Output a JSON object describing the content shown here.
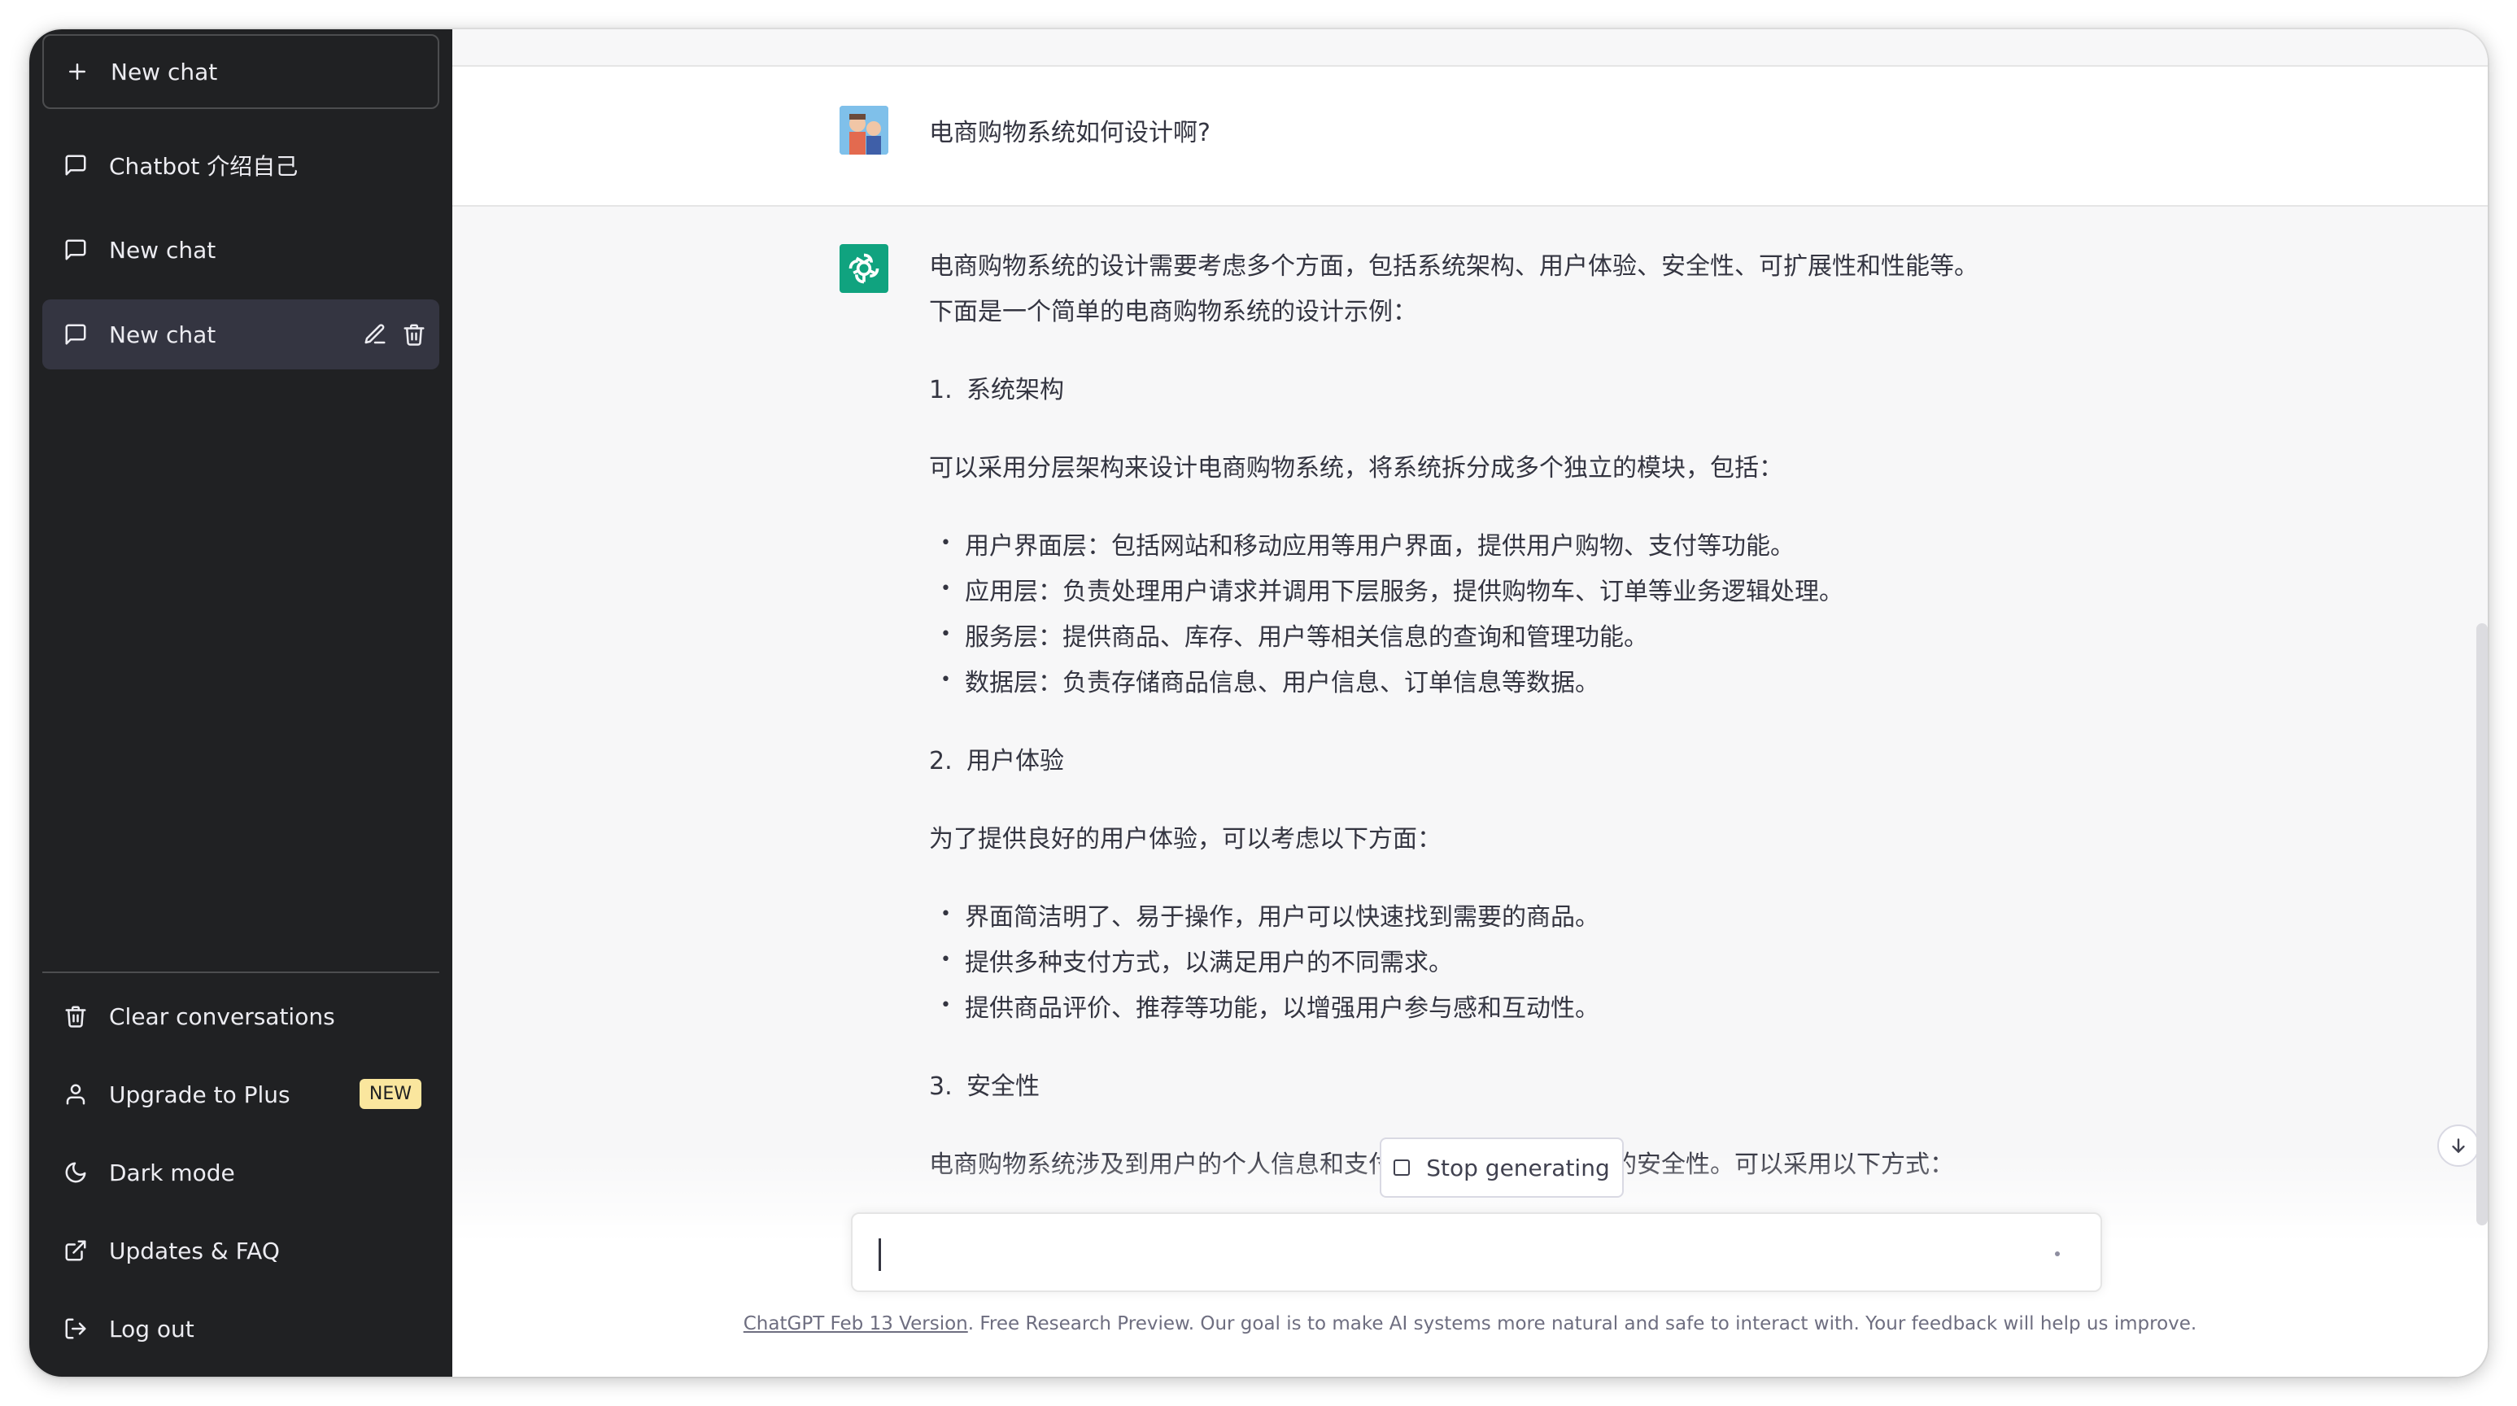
{
  "sidebar": {
    "new_chat": "New chat",
    "conversations": [
      {
        "label": "Chatbot 介绍自己"
      },
      {
        "label": "New chat"
      },
      {
        "label": "New chat"
      }
    ],
    "bottom": {
      "clear": "Clear conversations",
      "upgrade": "Upgrade to Plus",
      "upgrade_badge": "NEW",
      "dark_mode": "Dark mode",
      "updates": "Updates & FAQ",
      "logout": "Log out"
    }
  },
  "chat": {
    "user_message": "电商购物系统如何设计啊?",
    "answer": {
      "intro": "电商购物系统的设计需要考虑多个方面，包括系统架构、用户体验、安全性、可扩展性和性能等。下面是一个简单的电商购物系统的设计示例：",
      "sections": [
        {
          "num": "1.",
          "title": "系统架构",
          "desc": "可以采用分层架构来设计电商购物系统，将系统拆分成多个独立的模块，包括：",
          "bullets": [
            "用户界面层：包括网站和移动应用等用户界面，提供用户购物、支付等功能。",
            "应用层：负责处理用户请求并调用下层服务，提供购物车、订单等业务逻辑处理。",
            "服务层：提供商品、库存、用户等相关信息的查询和管理功能。",
            "数据层：负责存储商品信息、用户信息、订单信息等数据。"
          ]
        },
        {
          "num": "2.",
          "title": "用户体验",
          "desc": "为了提供良好的用户体验，可以考虑以下方面：",
          "bullets": [
            "界面简洁明了、易于操作，用户可以快速找到需要的商品。",
            "提供多种支付方式，以满足用户的不同需求。",
            "提供商品评价、推荐等功能，以增强用户参与感和互动性。"
          ]
        },
        {
          "num": "3.",
          "title": "安全性",
          "desc": "电商购物系统涉及到用户的个人信息和支付信息，需要保证数据的安全性。可以采用以下方式："
        }
      ]
    },
    "stop_button": "Stop generating"
  },
  "footer": {
    "version_link": "ChatGPT Feb 13 Version",
    "text": ". Free Research Preview. Our goal is to make AI systems more natural and safe to interact with. Your feedback will help us improve."
  },
  "icons": {
    "new_chat": "plus-icon",
    "conversation": "message-icon",
    "edit": "pencil-icon",
    "delete": "trash-icon",
    "clear": "trash-icon",
    "upgrade": "user-icon",
    "dark_mode": "moon-icon",
    "updates": "external-link-icon",
    "logout": "logout-icon",
    "scroll_down": "arrow-down-icon"
  },
  "colors": {
    "sidebar_bg": "#202123",
    "bot_avatar": "#10a37f",
    "badge": "#fae69e"
  }
}
